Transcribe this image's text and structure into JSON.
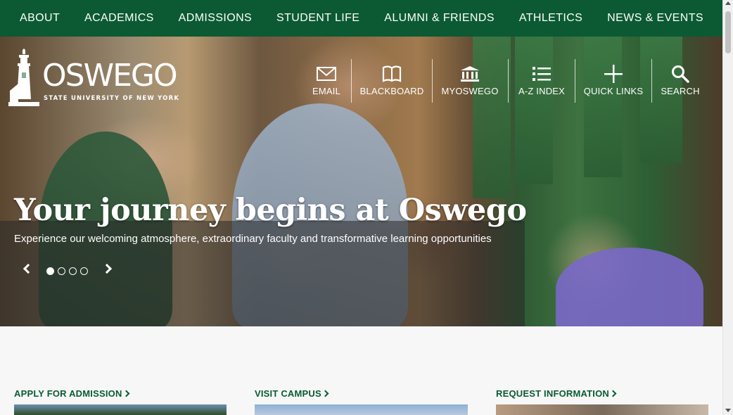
{
  "nav": {
    "items": [
      {
        "label": "ABOUT"
      },
      {
        "label": "ACADEMICS"
      },
      {
        "label": "ADMISSIONS"
      },
      {
        "label": "STUDENT LIFE"
      },
      {
        "label": "ALUMNI & FRIENDS"
      },
      {
        "label": "ATHLETICS"
      },
      {
        "label": "NEWS & EVENTS"
      }
    ]
  },
  "logo": {
    "wordmark": "OSWEGO",
    "tagline": "STATE UNIVERSITY OF NEW YORK"
  },
  "utility": {
    "email": "EMAIL",
    "blackboard": "BLACKBOARD",
    "myoswego": "MYOSWEGO",
    "az_index": "A-Z INDEX",
    "quick_links": "QUICK LINKS",
    "search": "SEARCH"
  },
  "hero": {
    "title": "Your journey begins at Oswego",
    "subtitle": "Experience our welcoming atmosphere, extraordinary faculty and transformative learning opportunities",
    "slide_count": 4,
    "active_slide": 1
  },
  "cards": {
    "apply": "APPLY FOR ADMISSION",
    "visit": "VISIT CAMPUS",
    "request": "REQUEST INFORMATION"
  },
  "colors": {
    "brand_green": "#0b5a33",
    "white": "#ffffff"
  }
}
